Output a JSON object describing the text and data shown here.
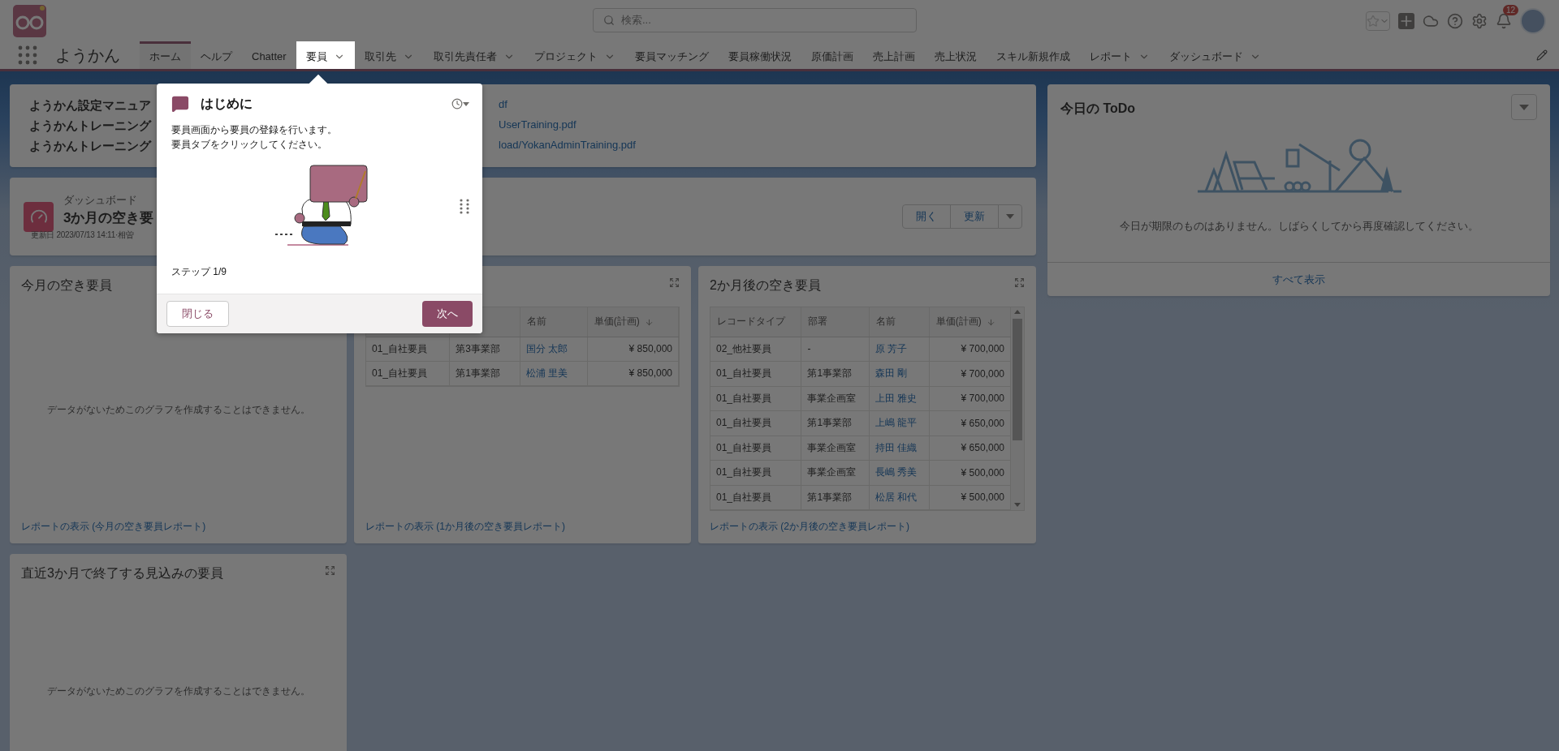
{
  "header": {
    "search_placeholder": "検索...",
    "notification_count": "12"
  },
  "nav": {
    "app_name": "ようかん",
    "tabs": [
      {
        "label": "ホーム",
        "selected": true,
        "highlighted": false,
        "dropdown": false
      },
      {
        "label": "ヘルプ",
        "selected": false,
        "highlighted": false,
        "dropdown": false
      },
      {
        "label": "Chatter",
        "selected": false,
        "highlighted": false,
        "dropdown": false
      },
      {
        "label": "要員",
        "selected": false,
        "highlighted": true,
        "dropdown": true
      },
      {
        "label": "取引先",
        "selected": false,
        "highlighted": false,
        "dropdown": true
      },
      {
        "label": "取引先責任者",
        "selected": false,
        "highlighted": false,
        "dropdown": true
      },
      {
        "label": "プロジェクト",
        "selected": false,
        "highlighted": false,
        "dropdown": true
      },
      {
        "label": "要員マッチング",
        "selected": false,
        "highlighted": false,
        "dropdown": false
      },
      {
        "label": "要員稼働状況",
        "selected": false,
        "highlighted": false,
        "dropdown": false
      },
      {
        "label": "原価計画",
        "selected": false,
        "highlighted": false,
        "dropdown": false
      },
      {
        "label": "売上計画",
        "selected": false,
        "highlighted": false,
        "dropdown": false
      },
      {
        "label": "売上状況",
        "selected": false,
        "highlighted": false,
        "dropdown": false
      },
      {
        "label": "スキル新規作成",
        "selected": false,
        "highlighted": false,
        "dropdown": false
      },
      {
        "label": "レポート",
        "selected": false,
        "highlighted": false,
        "dropdown": true
      },
      {
        "label": "ダッシュボード",
        "selected": false,
        "highlighted": false,
        "dropdown": true
      }
    ]
  },
  "links_card": {
    "lines": [
      {
        "title": "ようかん設定マニュア",
        "link": "df"
      },
      {
        "title": "ようかんトレーニング",
        "link": "UserTraining.pdf"
      },
      {
        "title": "ようかんトレーニング",
        "link": "load/YokanAdminTraining.pdf"
      }
    ]
  },
  "dashboard": {
    "label": "ダッシュボード",
    "title": "3か月の空き要",
    "updated": "更新日 2023/07/13 14:11·相曽",
    "buttons": [
      "開く",
      "更新"
    ]
  },
  "widgets": [
    {
      "kind": "empty",
      "title": "今月の空き要員",
      "message": "データがないためこのグラフを作成することはできません。",
      "footer": "レポートの表示 (今月の空き要員レポート)"
    },
    {
      "kind": "table",
      "expand_icon": true,
      "columns": [
        {
          "kind": "text"
        },
        {
          "kind": "text"
        },
        {
          "label": "名前",
          "kind": "link",
          "sorted": false
        },
        {
          "label": "単価(計画)",
          "kind": "number",
          "sorted": true
        }
      ],
      "rows": [
        [
          "01_自社要員",
          "第3事業部",
          "国分 太郎",
          "¥ 850,000"
        ],
        [
          "01_自社要員",
          "第1事業部",
          "松浦 里美",
          "¥ 850,000"
        ]
      ],
      "footer": "レポートの表示 (1か月後の空き要員レポート)"
    },
    {
      "kind": "table",
      "title": "2か月後の空き要員",
      "expand_icon": true,
      "scrollbar": true,
      "columns": [
        {
          "label": "レコードタイプ",
          "kind": "text",
          "sorted": false
        },
        {
          "label": "部署",
          "kind": "text",
          "sorted": false
        },
        {
          "label": "名前",
          "kind": "link",
          "sorted": false
        },
        {
          "label": "単価(計画)",
          "kind": "number",
          "sorted": true
        }
      ],
      "rows": [
        [
          "02_他社要員",
          "-",
          "原 芳子",
          "¥ 700,000"
        ],
        [
          "01_自社要員",
          "第1事業部",
          "森田 剛",
          "¥ 700,000"
        ],
        [
          "01_自社要員",
          "事業企画室",
          "上田 雅史",
          "¥ 700,000"
        ],
        [
          "01_自社要員",
          "第1事業部",
          "上嶋 龍平",
          "¥ 650,000"
        ],
        [
          "01_自社要員",
          "事業企画室",
          "持田 佳織",
          "¥ 650,000"
        ],
        [
          "01_自社要員",
          "事業企画室",
          "長嶋 秀美",
          "¥ 500,000"
        ],
        [
          "01_自社要員",
          "第1事業部",
          "松居 和代",
          "¥ 500,000"
        ]
      ],
      "footer": "レポートの表示 (2か月後の空き要員レポート)"
    },
    {
      "kind": "empty",
      "title": "直近3か月で終了する見込みの要員",
      "expand_icon": true,
      "message": "データがないためこのグラフを作成することはできません。"
    }
  ],
  "todo": {
    "title": "今日の ToDo",
    "message": "今日が期限のものはありません。しばらくしてから再度確認してください。",
    "footer": "すべて表示"
  },
  "popover": {
    "title": "はじめに",
    "body": [
      "要員画面から要員の登録を行います。",
      "要員タブをクリックしてください。"
    ],
    "step": "ステップ 1/9",
    "close": "閉じる",
    "next": "次へ"
  }
}
